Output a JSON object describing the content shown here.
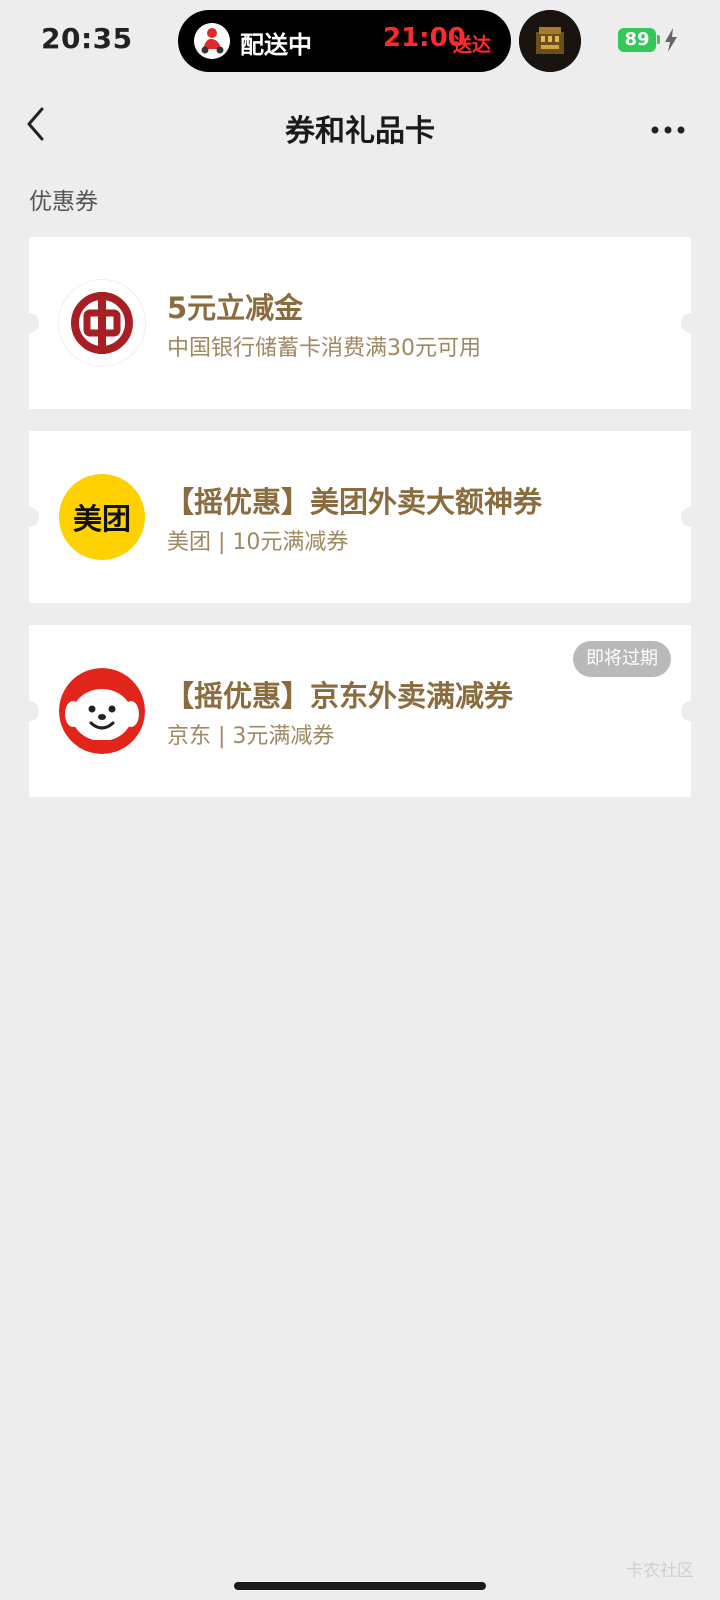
{
  "status_bar": {
    "time": "20:35",
    "island": {
      "status": "配送中",
      "time": "21:00",
      "suffix": "送达"
    },
    "battery": "89",
    "icons": [
      "rider-avatar-icon",
      "delivery-thumbnail-icon",
      "charging-bolt-icon"
    ]
  },
  "nav": {
    "title": "券和礼品卡",
    "icons": [
      "back-chevron-icon",
      "more-dots-icon"
    ]
  },
  "section": {
    "title": "优惠券"
  },
  "coupons": [
    {
      "title": "5元立减金",
      "subtitle": "中国银行储蓄卡消费满30元可用",
      "logo": "bank-of-china-logo"
    },
    {
      "title": "【摇优惠】美团外卖大额神券",
      "subtitle": "美团 | 10元满减券",
      "logo": "meituan-logo",
      "logo_text": "美团"
    },
    {
      "title": "【摇优惠】京东外卖满减券",
      "subtitle": "京东 | 3元满减券",
      "logo": "jd-joy-logo",
      "badge": "即将过期"
    }
  ],
  "watermark": "卡农社区",
  "colors": {
    "background": "#ededed",
    "coupon_title": "#8b6c3e",
    "coupon_subtitle": "#a08863",
    "island_time": "#ff2b2b",
    "battery": "#34c759",
    "meituan_yellow": "#ffd100",
    "bank_red": "#a71e23",
    "jd_red": "#e1251b"
  }
}
